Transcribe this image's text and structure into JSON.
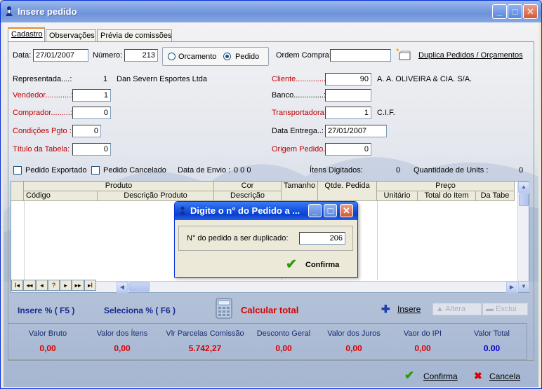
{
  "window": {
    "title": "Insere pedido"
  },
  "tabs": [
    {
      "label": "Cadastro"
    },
    {
      "label": "Observações"
    },
    {
      "label": "Prévia de comissões"
    }
  ],
  "form": {
    "data_label": "Data:",
    "data_value": "27/01/2007",
    "numero_label": "Número:",
    "numero_value": "213",
    "orcamento_label": "Orcamento",
    "pedido_label": "Pedido",
    "tipo_selected": "Pedido",
    "ordem_compra_label": "Ordem Compra:",
    "ordem_compra_value": "",
    "duplica_label": "Duplica Pedidos / Orçamentos",
    "representada_label": "Representada....:",
    "representada_code": "1",
    "representada_name": "Dan Severn Esportes Ltda",
    "vendedor_label": "Vendedor............:",
    "vendedor_value": "1",
    "comprador_label": "Comprador.........:",
    "comprador_value": "0",
    "condicoes_label": "Condições Pgto :",
    "condicoes_value": "0",
    "titulo_tabela_label": "Título da Tabela:",
    "titulo_tabela_value": "0",
    "cliente_label": "Cliente...............:",
    "cliente_value": "90",
    "cliente_name": "A. A. OLIVEIRA & CIA. S/A.",
    "banco_label": "Banco..............:",
    "banco_value": "",
    "transportadora_label": "Transportadora:",
    "transportadora_value": "1",
    "transportadora_name": "C.I.F.",
    "data_entrega_label": "Data Entrega..:",
    "data_entrega_value": "27/01/2007",
    "origem_label": "Origem Pedido.:",
    "origem_value": "0",
    "pedido_exportado_label": "Pedido Exportado",
    "pedido_cancelado_label": "Pedido Cancelado",
    "data_envio_label": "Data de Envio :",
    "data_envio_value": "0 0 0",
    "itens_digitados_label": "Ítens Digitados:",
    "itens_digitados_value": "0",
    "quantidade_units_label": "Quantidade de Units :",
    "quantidade_units_value": "0"
  },
  "grid": {
    "groups": [
      "Produto",
      "Cor",
      "Tamanho",
      "Qtde. Pedida",
      "Preço"
    ],
    "columns": [
      "Código",
      "Descrição Produto",
      "Descrição",
      "Unitário",
      "Total do Item",
      "Da Tabe"
    ],
    "nav_buttons": [
      "I◂",
      "◂◂",
      "◂",
      "?",
      "▸",
      "▸▸",
      "▸I"
    ]
  },
  "actions": {
    "insere_f5": "Insere % ( F5 )",
    "seleciona_f6": "Seleciona % ( F6 )",
    "calcular_total": "Calcular total",
    "insere": "Insere",
    "altera": "Altera",
    "exclui": "Exclui"
  },
  "summary": [
    {
      "label": "Valor Bruto",
      "value": "0,00"
    },
    {
      "label": "Valor dos Ítens",
      "value": "0,00"
    },
    {
      "label": "Vlr Parcelas Comissão",
      "value": "5.742,27"
    },
    {
      "label": "Desconto Geral",
      "value": "0,00"
    },
    {
      "label": "Valor dos Juros",
      "value": "0,00"
    },
    {
      "label": "Vaor do IPI",
      "value": "0,00"
    },
    {
      "label": "Valor Total",
      "value": "0.00"
    }
  ],
  "footer": {
    "confirma": "Confirma",
    "cancela": "Cancela"
  },
  "dialog": {
    "title": "Digite o n° do Pedido a ...",
    "prompt": "N° do pedido a ser duplicado:",
    "value": "206",
    "confirma": "Confirma"
  },
  "colors": {
    "accent_red": "#d40000",
    "title_blue": "#0a40cf",
    "summary_blue": "#0000cc"
  }
}
